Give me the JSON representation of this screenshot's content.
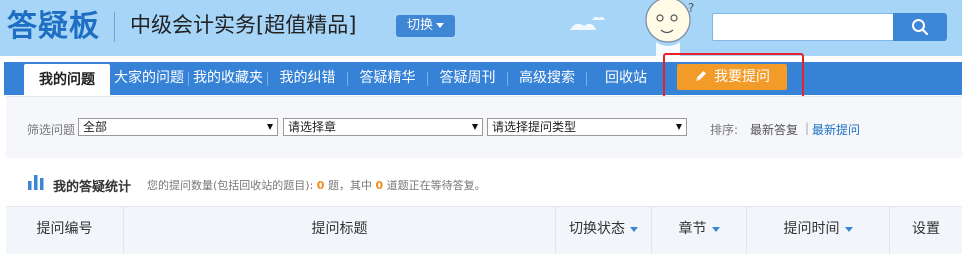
{
  "header": {
    "logo": "答疑板",
    "course_title": "中级会计实务[超值精品]",
    "switch_label": "切换",
    "search_placeholder": ""
  },
  "nav": {
    "items": [
      {
        "label": "我的问题",
        "active": true
      },
      {
        "label": "大家的问题"
      },
      {
        "label": "我的收藏夹"
      },
      {
        "label": "我的纠错"
      },
      {
        "label": "答疑精华"
      },
      {
        "label": "答疑周刊"
      },
      {
        "label": "高级搜索"
      },
      {
        "label": "回收站"
      }
    ],
    "ask_label": "我要提问"
  },
  "filter": {
    "label": "筛选问题",
    "select_1": "全部",
    "select_2": "请选择章",
    "select_3": "请选择提问类型",
    "sort_label": "排序:",
    "sort_latest_answer": "最新答复",
    "sort_latest_question": "最新提问",
    "sort_sep": "|"
  },
  "stats": {
    "title": "我的答疑统计",
    "text_1": "您的提问数量(包括回收站的题目):",
    "count_total": "0",
    "text_2": "题，其中",
    "count_pending": "0",
    "text_3": "道题正在等待答复。"
  },
  "table": {
    "columns": [
      "提问编号",
      "提问标题",
      "切换状态",
      "章节",
      "提问时间",
      "设置"
    ]
  },
  "colors": {
    "header_bg": "#a7d5f8",
    "nav_bg": "#3582d6",
    "ask_button": "#f39b28",
    "highlight": "#e8212a",
    "link": "#1e6fc4",
    "count": "#f08a1b"
  },
  "icons": {
    "search": "search-icon",
    "pencil": "pencil-icon",
    "chart": "bar-chart-icon",
    "caret": "caret-down-icon"
  }
}
